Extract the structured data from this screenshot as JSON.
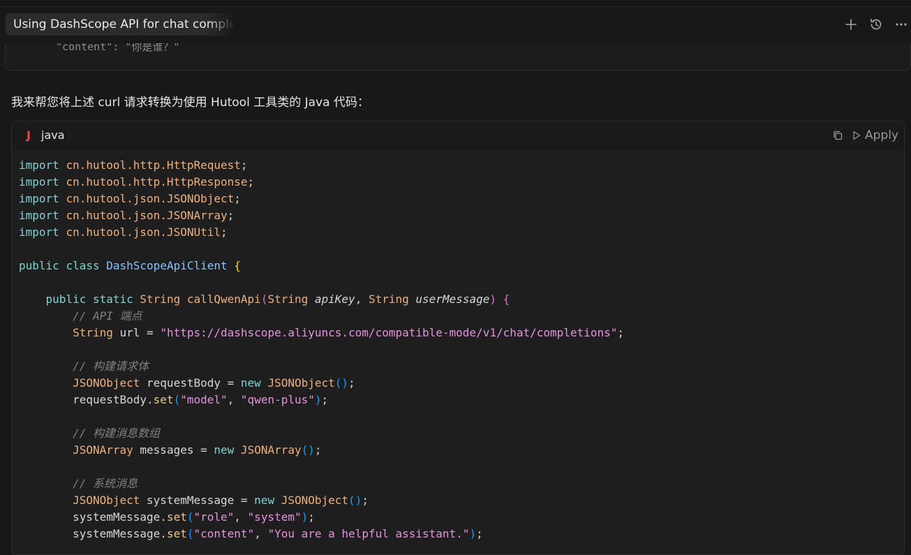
{
  "tab": {
    "title": "Using DashScope API for chat completions"
  },
  "toolbar": {
    "new_icon": "plus-icon",
    "history_icon": "history-icon",
    "more_icon": "more-icon"
  },
  "previous_block": {
    "line": "\"content\": \"你是谁？\""
  },
  "message": {
    "intro": "我来帮您将上述 curl 请求转换为使用 Hutool 工具类的 Java 代码："
  },
  "code_block": {
    "language": "java",
    "language_icon": "java-icon",
    "copy_icon": "copy-icon",
    "apply_label": "Apply",
    "lines": [
      [
        [
          "kw",
          "import"
        ],
        [
          "pun",
          " "
        ],
        [
          "pkg",
          "cn.hutool.http.HttpRequest"
        ],
        [
          "pun",
          ";"
        ]
      ],
      [
        [
          "kw",
          "import"
        ],
        [
          "pun",
          " "
        ],
        [
          "pkg",
          "cn.hutool.http.HttpResponse"
        ],
        [
          "pun",
          ";"
        ]
      ],
      [
        [
          "kw",
          "import"
        ],
        [
          "pun",
          " "
        ],
        [
          "pkg",
          "cn.hutool.json.JSONObject"
        ],
        [
          "pun",
          ";"
        ]
      ],
      [
        [
          "kw",
          "import"
        ],
        [
          "pun",
          " "
        ],
        [
          "pkg",
          "cn.hutool.json.JSONArray"
        ],
        [
          "pun",
          ";"
        ]
      ],
      [
        [
          "kw",
          "import"
        ],
        [
          "pun",
          " "
        ],
        [
          "pkg",
          "cn.hutool.json.JSONUtil"
        ],
        [
          "pun",
          ";"
        ]
      ],
      [],
      [
        [
          "kw",
          "public"
        ],
        [
          "pun",
          " "
        ],
        [
          "kw",
          "class"
        ],
        [
          "pun",
          " "
        ],
        [
          "cls",
          "DashScopeApiClient"
        ],
        [
          "pun",
          " "
        ],
        [
          "br1",
          "{"
        ]
      ],
      [],
      [
        [
          "pun",
          "    "
        ],
        [
          "kw",
          "public"
        ],
        [
          "pun",
          " "
        ],
        [
          "kw",
          "static"
        ],
        [
          "pun",
          " "
        ],
        [
          "typ",
          "String"
        ],
        [
          "pun",
          " "
        ],
        [
          "fn",
          "callQwenApi"
        ],
        [
          "br2",
          "("
        ],
        [
          "typ",
          "String"
        ],
        [
          "pun",
          " "
        ],
        [
          "prm",
          "apiKey"
        ],
        [
          "pun",
          ", "
        ],
        [
          "typ",
          "String"
        ],
        [
          "pun",
          " "
        ],
        [
          "prm",
          "userMessage"
        ],
        [
          "br2",
          ")"
        ],
        [
          "pun",
          " "
        ],
        [
          "br2",
          "{"
        ]
      ],
      [
        [
          "pun",
          "        "
        ],
        [
          "cmt",
          "// API 端点"
        ]
      ],
      [
        [
          "pun",
          "        "
        ],
        [
          "typ",
          "String"
        ],
        [
          "pun",
          " "
        ],
        [
          "var",
          "url"
        ],
        [
          "pun",
          " = "
        ],
        [
          "str",
          "\"https://dashscope.aliyuncs.com/compatible-mode/v1/chat/completions\""
        ],
        [
          "pun",
          ";"
        ]
      ],
      [],
      [
        [
          "pun",
          "        "
        ],
        [
          "cmt",
          "// 构建请求体"
        ]
      ],
      [
        [
          "pun",
          "        "
        ],
        [
          "typ",
          "JSONObject"
        ],
        [
          "pun",
          " "
        ],
        [
          "var",
          "requestBody"
        ],
        [
          "pun",
          " = "
        ],
        [
          "kw",
          "new"
        ],
        [
          "pun",
          " "
        ],
        [
          "typ",
          "JSONObject"
        ],
        [
          "br3",
          "()"
        ],
        [
          "pun",
          ";"
        ]
      ],
      [
        [
          "pun",
          "        "
        ],
        [
          "var",
          "requestBody"
        ],
        [
          "pun",
          "."
        ],
        [
          "mth",
          "set"
        ],
        [
          "br3",
          "("
        ],
        [
          "str",
          "\"model\""
        ],
        [
          "pun",
          ", "
        ],
        [
          "str",
          "\"qwen-plus\""
        ],
        [
          "br3",
          ")"
        ],
        [
          "pun",
          ";"
        ]
      ],
      [],
      [
        [
          "pun",
          "        "
        ],
        [
          "cmt",
          "// 构建消息数组"
        ]
      ],
      [
        [
          "pun",
          "        "
        ],
        [
          "typ",
          "JSONArray"
        ],
        [
          "pun",
          " "
        ],
        [
          "var",
          "messages"
        ],
        [
          "pun",
          " = "
        ],
        [
          "kw",
          "new"
        ],
        [
          "pun",
          " "
        ],
        [
          "typ",
          "JSONArray"
        ],
        [
          "br3",
          "()"
        ],
        [
          "pun",
          ";"
        ]
      ],
      [],
      [
        [
          "pun",
          "        "
        ],
        [
          "cmt",
          "// 系统消息"
        ]
      ],
      [
        [
          "pun",
          "        "
        ],
        [
          "typ",
          "JSONObject"
        ],
        [
          "pun",
          " "
        ],
        [
          "var",
          "systemMessage"
        ],
        [
          "pun",
          " = "
        ],
        [
          "kw",
          "new"
        ],
        [
          "pun",
          " "
        ],
        [
          "typ",
          "JSONObject"
        ],
        [
          "br3",
          "()"
        ],
        [
          "pun",
          ";"
        ]
      ],
      [
        [
          "pun",
          "        "
        ],
        [
          "var",
          "systemMessage"
        ],
        [
          "pun",
          "."
        ],
        [
          "mth",
          "set"
        ],
        [
          "br3",
          "("
        ],
        [
          "str",
          "\"role\""
        ],
        [
          "pun",
          ", "
        ],
        [
          "str",
          "\"system\""
        ],
        [
          "br3",
          ")"
        ],
        [
          "pun",
          ";"
        ]
      ],
      [
        [
          "pun",
          "        "
        ],
        [
          "var",
          "systemMessage"
        ],
        [
          "pun",
          "."
        ],
        [
          "mth",
          "set"
        ],
        [
          "br3",
          "("
        ],
        [
          "str",
          "\"content\""
        ],
        [
          "pun",
          ", "
        ],
        [
          "str",
          "\"You are a helpful assistant.\""
        ],
        [
          "br3",
          ")"
        ],
        [
          "pun",
          ";"
        ]
      ]
    ]
  }
}
